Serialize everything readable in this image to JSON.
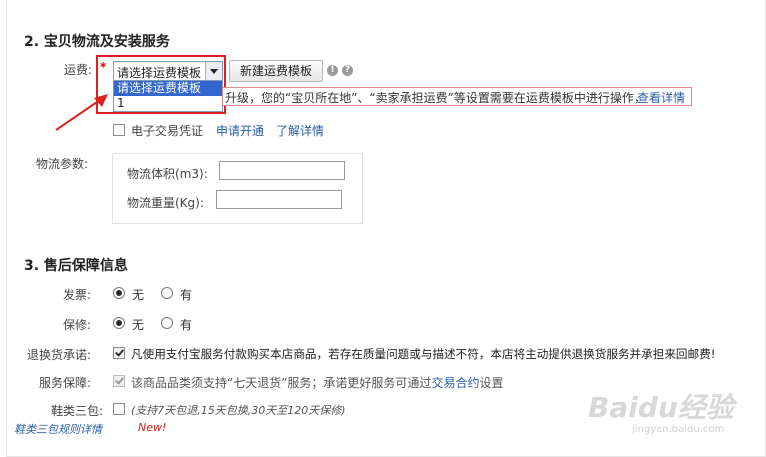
{
  "section2": {
    "title": "2. 宝贝物流及安装服务",
    "freight_label": "运费:",
    "required_mark": "*",
    "select_value": "请选择运费模板",
    "dropdown_options": [
      "请选择运费模板",
      "1"
    ],
    "new_template_button": "新建运费模板",
    "notice_text": "升级，您的“宝贝所在地”、“卖家承担运费”等设置需要在运费模板中进行操作，",
    "notice_link": "查看详情",
    "etrade_label": "电子交易凭证",
    "etrade_apply_link": "申请开通",
    "etrade_info_link": "了解详情",
    "logistics_label": "物流参数:",
    "volume_label": "物流体积(m3):",
    "volume_value": "",
    "weight_label": "物流重量(Kg):",
    "weight_value": ""
  },
  "section3": {
    "title": "3. 售后保障信息",
    "invoice_label": "发票:",
    "invoice_options": [
      "无",
      "有"
    ],
    "invoice_selected": "无",
    "warranty_label": "保修:",
    "warranty_options": [
      "无",
      "有"
    ],
    "warranty_selected": "无",
    "return_label": "退换货承诺:",
    "return_text": "凡使用支付宝服务付款购买本店商品，若存在质量问题或与描述不符，本店将主动提供退换货服务并承担来回邮费!",
    "service_label": "服务保障:",
    "service_text_prefix": "该商品品类须支持“七天退货”服务；承诺更好服务可通过",
    "service_link": "交易合约",
    "service_text_suffix": "设置",
    "shoes_label": "鞋类三包:",
    "shoes_text": "(支持7天包退,15天包换,30天至120天保修)",
    "shoes_rules_link": "鞋类三包规则详情",
    "new_badge": "New!"
  },
  "watermark": {
    "logo": "Baidu经验",
    "url": "jingyan.baidu.com"
  },
  "colors": {
    "highlight_frame": "#e02020",
    "link": "#2a5ea8",
    "selected_option_bg": "#3366cc",
    "new_badge": "#e02020"
  }
}
